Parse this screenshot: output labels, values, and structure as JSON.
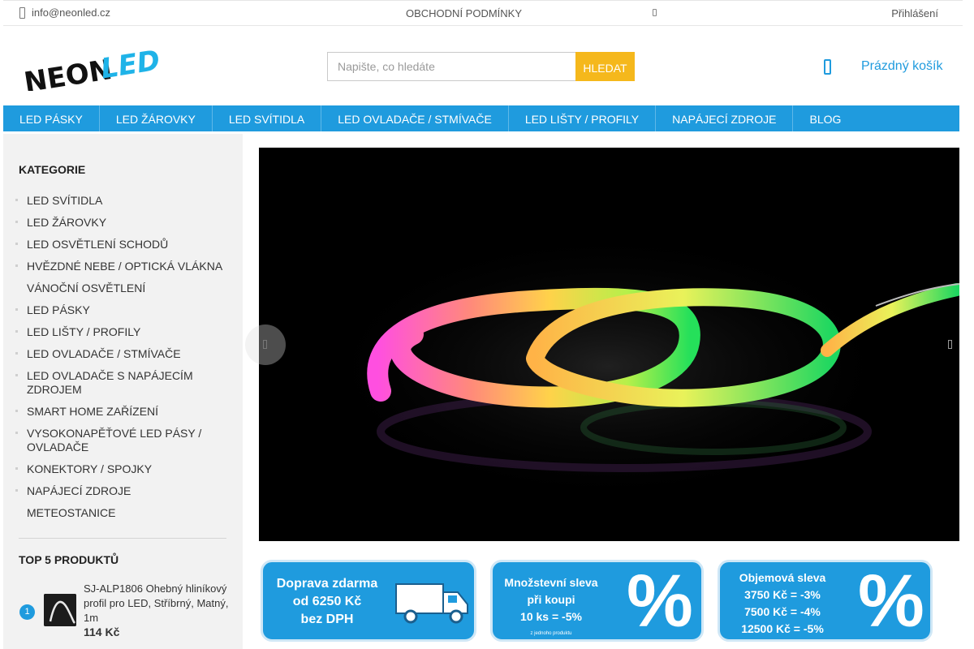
{
  "topbar": {
    "email": "info@neonled.cz",
    "terms": "OBCHODNÍ PODMÍNKY",
    "login": "Přihlášení"
  },
  "logo": {
    "text_neon": "NEON",
    "text_led": "LED"
  },
  "search": {
    "placeholder": "Napište, co hledáte",
    "button": "HLEDAT"
  },
  "cart": {
    "label": "Prázdný košík"
  },
  "nav": [
    "LED PÁSKY",
    "LED ŽÁROVKY",
    "LED SVÍTIDLA",
    "LED OVLADAČE / STMÍVAČE",
    "LED LIŠTY / PROFILY",
    "NAPÁJECÍ ZDROJE",
    "BLOG"
  ],
  "sidebar": {
    "categories_title": "KATEGORIE",
    "categories": [
      "LED SVÍTIDLA",
      "LED ŽÁROVKY",
      "LED OSVĚTLENÍ SCHODŮ",
      "HVĚZDNÉ NEBE / OPTICKÁ VLÁKNA",
      "VÁNOČNÍ OSVĚTLENÍ",
      "LED PÁSKY",
      "LED LIŠTY / PROFILY",
      "LED OVLADAČE / STMÍVAČE",
      "LED OVLADAČE S NAPÁJECÍM ZDROJEM",
      "SMART HOME ZAŘÍZENÍ",
      "VYSOKONAPĚŤOVÉ LED PÁSY / OVLADAČE",
      "KONEKTORY / SPOJKY",
      "NAPÁJECÍ ZDROJE",
      "METEOSTANICE"
    ],
    "top_title": "TOP 5 PRODUKTŮ",
    "top_products": [
      {
        "rank": "1",
        "name": "SJ-ALP1806 Ohebný hliníkový profil pro LED, Stříbrný, Matný, 1m",
        "price": "114 Kč"
      }
    ]
  },
  "banners": [
    {
      "lines": [
        "Doprava zdarma",
        "od 6250 Kč",
        "bez DPH"
      ]
    },
    {
      "lines": [
        "Množstevní sleva",
        "při koupi",
        "10 ks = -5%"
      ],
      "small": "z jednoho produktu",
      "pct": "%"
    },
    {
      "lines": [
        "Objemová sleva",
        "3750 Kč = -3%",
        "7500 Kč = -4%",
        "12500 Kč = -5%"
      ],
      "pct": "%"
    }
  ],
  "colors": {
    "accent": "#1f9bde",
    "search_button": "#f5b81c",
    "sidebar_bg": "#f2f2f2"
  },
  "icons": {
    "email": "mail-icon",
    "terms_arrow": "arrow-icon",
    "cart": "cart-icon"
  }
}
